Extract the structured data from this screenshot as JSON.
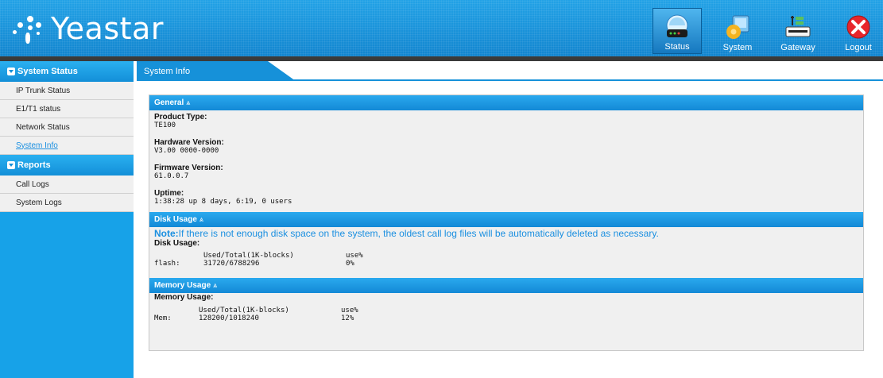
{
  "brand": {
    "name": "Yeastar"
  },
  "topnav": {
    "items": [
      {
        "label": "Status",
        "icon": "status-icon"
      },
      {
        "label": "System",
        "icon": "system-icon"
      },
      {
        "label": "Gateway",
        "icon": "gateway-icon"
      },
      {
        "label": "Logout",
        "icon": "logout-icon"
      }
    ]
  },
  "sidebar": {
    "sections": [
      {
        "label": "System Status",
        "items": [
          "IP Trunk Status",
          "E1/T1 status",
          "Network Status",
          "System Info"
        ]
      },
      {
        "label": "Reports",
        "items": [
          "Call Logs",
          "System Logs"
        ]
      }
    ]
  },
  "tab": {
    "label": "System Info"
  },
  "general": {
    "title": "General",
    "product_type_label": "Product Type:",
    "product_type": "TE100",
    "hardware_label": "Hardware Version:",
    "hardware": "V3.00 0000-0000",
    "firmware_label": "Firmware Version:",
    "firmware": "61.0.0.7",
    "uptime_label": "Uptime:",
    "uptime": "1:38:28 up 8 days, 6:19, 0 users"
  },
  "disk": {
    "title": "Disk Usage",
    "note_prefix": "Note:",
    "note_text": "If there is not enough disk space on the system, the oldest call log files will be automatically deleted as necessary.",
    "label": "Disk Usage:",
    "header_cols": "Used/Total(1K-blocks)",
    "header_use": "use%",
    "row_name": "flash:",
    "row_used": "31720/6788296",
    "row_pct": "0%"
  },
  "memory": {
    "title": "Memory Usage",
    "label": "Memory Usage:",
    "header_cols": "Used/Total(1K-blocks)",
    "header_use": "use%",
    "row_name": "Mem:",
    "row_used": "128200/1018240",
    "row_pct": "12%"
  },
  "colors": {
    "accent": "#1691d9",
    "header": "#1a8fd8",
    "panel": "#f0f0f0",
    "note": "#1a8fe0"
  }
}
